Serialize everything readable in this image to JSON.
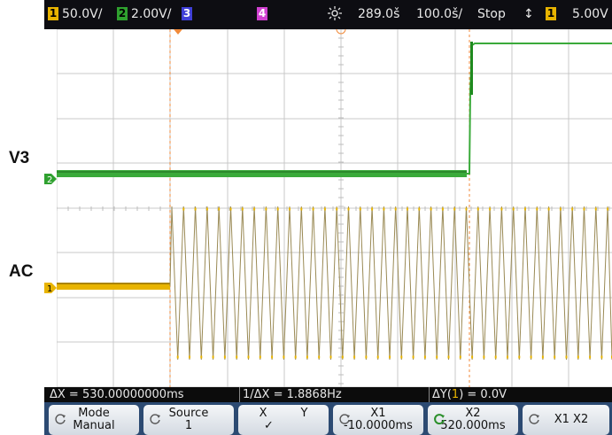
{
  "labels": {
    "v3": "V3",
    "ac": "AC"
  },
  "topbar": {
    "ch1_num": "1",
    "ch1_scale": "50.0V/",
    "ch2_num": "2",
    "ch2_scale": "2.00V/",
    "ch3_num": "3",
    "ch4_num": "4",
    "delay": "289.0š",
    "timebase": "100.0š/",
    "run_state": "Stop",
    "trig_icon": "↕",
    "trig_ch": "1",
    "trig_level": "5.00V"
  },
  "measure": {
    "dx": "ΔX = 530.00000000ms",
    "inv_dx": "1/ΔX = 1.8868Hz",
    "dy_prefix": "ΔY(",
    "dy_ch": "1",
    "dy_suffix": ") = 0.0V"
  },
  "softkeys": {
    "mode_l1": "Mode",
    "mode_l2": "Manual",
    "source_l1": "Source",
    "source_l2": "1",
    "x_label": "X",
    "y_label": "Y",
    "x_check": "✓",
    "x1_l1": "X1",
    "x1_l2": "-10.0000ms",
    "x2_l1": "X2",
    "x2_l2": "520.000ms",
    "x1x2_label": "X1 X2"
  },
  "channel_markers": {
    "ch2": "2",
    "ch1": "1"
  },
  "colors": {
    "ch1": "#e8b400",
    "ch2": "#2fa12f",
    "ch3": "#3b3bd0",
    "ch4": "#d040d0",
    "cursor": "#f08a3a",
    "softkey_bg": "#2c4a72",
    "topbar_bg": "#0d0d12"
  },
  "icons": {
    "brightness": "brightness-icon",
    "rotate": "rotate-knob-icon"
  }
}
